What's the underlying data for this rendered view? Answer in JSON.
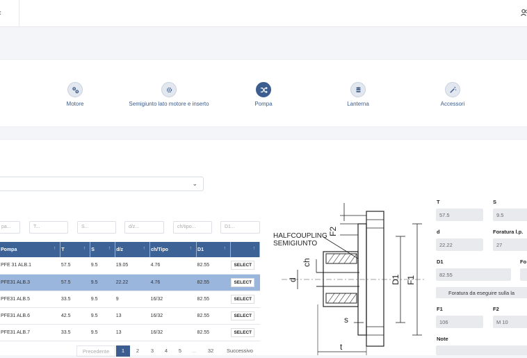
{
  "topbar": {
    "menu_icon": "chevron-left-icon",
    "user_icon": "user-group-icon"
  },
  "steps": [
    {
      "label": "Motore",
      "icon": "cog-network-icon",
      "active": false
    },
    {
      "label": "Semigiunto lato motore e inserto",
      "icon": "gear-icon",
      "active": false
    },
    {
      "label": "Pompa",
      "icon": "shuffle-icon",
      "active": true
    },
    {
      "label": "Lanterna",
      "icon": "database-icon",
      "active": false
    },
    {
      "label": "Accessori",
      "icon": "magic-wand-icon",
      "active": false
    }
  ],
  "filters": [
    "pa...",
    "T...",
    "S...",
    "d/z...",
    "ch/tipo...",
    "D1..."
  ],
  "table": {
    "headers": [
      "Pompa",
      "T",
      "S",
      "d/z",
      "ch/Tipo",
      "D1",
      ""
    ],
    "rows": [
      {
        "cells": [
          "PFE 31 ALB.1",
          "57.5",
          "9.5",
          "19.05",
          "4.76",
          "82.55"
        ],
        "action": "SELECT",
        "selected": false
      },
      {
        "cells": [
          "PFE31 ALB.3",
          "57.5",
          "9.5",
          "22.22",
          "4.76",
          "82.55"
        ],
        "action": "SELECT",
        "selected": true
      },
      {
        "cells": [
          "PFE31 ALB.5",
          "33.5",
          "9.5",
          "9",
          "16/32",
          "82.55"
        ],
        "action": "SELECT",
        "selected": false
      },
      {
        "cells": [
          "PFE31 ALB.6",
          "42.5",
          "9.5",
          "13",
          "16/32",
          "82.55"
        ],
        "action": "SELECT",
        "selected": false
      },
      {
        "cells": [
          "PFE31 ALB.7",
          "33.5",
          "9.5",
          "13",
          "16/32",
          "82.55"
        ],
        "action": "SELECT",
        "selected": false
      }
    ]
  },
  "pagination": {
    "prev": "Precedente",
    "pages": [
      "1",
      "2",
      "3",
      "4",
      "5",
      "...",
      "32"
    ],
    "current": "1",
    "next": "Successivo"
  },
  "diagram": {
    "title_line1": "HALFCOUPLING",
    "title_line2": "SEMIGIUNTO",
    "labels": {
      "F2": "F2",
      "ch": "ch",
      "d": "d",
      "D1": "D1",
      "F1": "F1",
      "s": "s",
      "t": "t"
    }
  },
  "form": {
    "T_label": "T",
    "T_value": "57.5",
    "S_label": "S",
    "S_value": "9.5",
    "d_label": "d",
    "d_value": "22.22",
    "foratura_label": "Foratura l.p.",
    "foratura_value": "27",
    "D1_label": "D1",
    "D1_value": "82.55",
    "fo_label": "Fo",
    "bar_text": "Foratura da eseguire sulla la",
    "F1_label": "F1",
    "F1_value": "106",
    "F2_label": "F2",
    "F2_value": "M 10",
    "note_label": "Note"
  }
}
